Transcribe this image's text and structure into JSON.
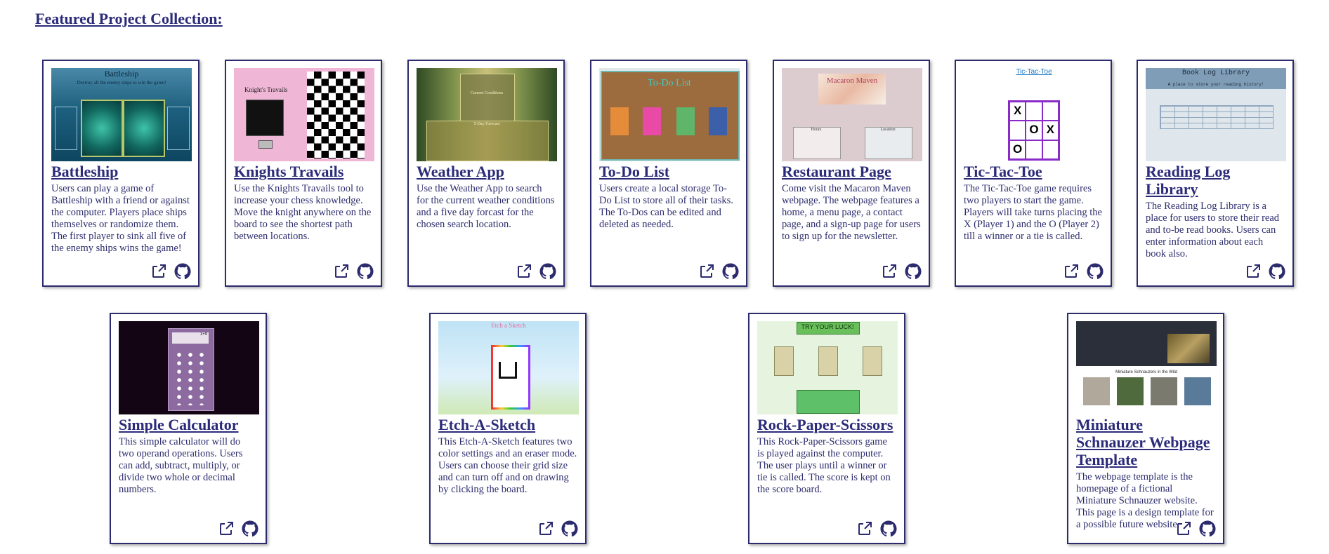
{
  "section_title": "Featured Project Collection:",
  "colors": {
    "accent": "#2b2b7a",
    "text": "#2d2d6e",
    "card_border": "#2b2b6e"
  },
  "projects": [
    {
      "title": "Battleship",
      "description": "Users can play a game of Battleship with a friend or against the computer. Players place ships themselves or randomize them. The first player to sink all five of the enemy ships wins the game!",
      "thumb_text": {
        "heading": "Battleship",
        "sub": "Destroy all the enemy ships to win the game!"
      }
    },
    {
      "title": "Knights Travails",
      "description": "Use the Knights Travails tool to increase your chess knowledge. Move the knight anywhere on the board to see the shortest path between locations.",
      "thumb_text": {
        "heading": "Knight's Travails"
      }
    },
    {
      "title": "Weather App",
      "description": "Use the Weather App to search for the current weather conditions and a five day forcast for the chosen search location.",
      "thumb_text": {
        "heading": "Current Conditions",
        "sub": "5-Day Forecast"
      }
    },
    {
      "title": "To-Do List",
      "description": "Users create a local storage To-Do List to store all of their tasks. The To-Dos can be edited and deleted as needed.",
      "thumb_text": {
        "heading": "To-Do List"
      }
    },
    {
      "title": "Restaurant Page",
      "description": "Come visit the Macaron Maven webpage. The webpage features a home, a menu page, a contact page, and a sign-up page for users to sign up for the newsletter.",
      "thumb_text": {
        "heading": "Macaron Maven",
        "hours": "Hours",
        "location": "Location"
      }
    },
    {
      "title": "Tic-Tac-Toe",
      "description": "The Tic-Tac-Toe game requires two players to start the game. Players will take turns placing the X (Player 1) and the O (Player 2) till a winner or a tie is called.",
      "thumb_text": {
        "heading": "Tic-Tac-Toe",
        "board": [
          "X",
          "",
          "",
          "",
          "O",
          "X",
          "O",
          "",
          ""
        ]
      }
    },
    {
      "title": "Reading Log Library",
      "description": "The Reading Log Library is a place for users to store their read and to-be read books. Users can enter information about each book also.",
      "thumb_text": {
        "heading": "Book Log Library",
        "sub": "A place to store your reading history!"
      }
    },
    {
      "title": "Simple Calculator",
      "description": "This simple calculator will do two operand operations. Users can add, subtract, multiply, or divide two whole or decimal numbers.",
      "thumb_text": {
        "display": "1+9"
      }
    },
    {
      "title": "Etch-A-Sketch",
      "description": "This Etch-A-Sketch features two color settings and an eraser mode. Users can choose their grid size and can turn off and on drawing by clicking the board.",
      "thumb_text": {
        "heading": "Etch a Sketch"
      }
    },
    {
      "title": "Rock-Paper-Scissors",
      "description": "This Rock-Paper-Scissors game is played against the computer. The user plays until a winner or tie is called. The score is kept on the score board.",
      "thumb_text": {
        "heading": "TRY YOUR LUCK!"
      }
    },
    {
      "title": "Miniature Schnauzer Webpage Template",
      "description": "The webpage template is the homepage of a fictional Miniature Schnauzer website. This page is a design template for a possible future website.",
      "thumb_text": {
        "sub": "Miniature Schnauzers in the Wild"
      }
    }
  ]
}
